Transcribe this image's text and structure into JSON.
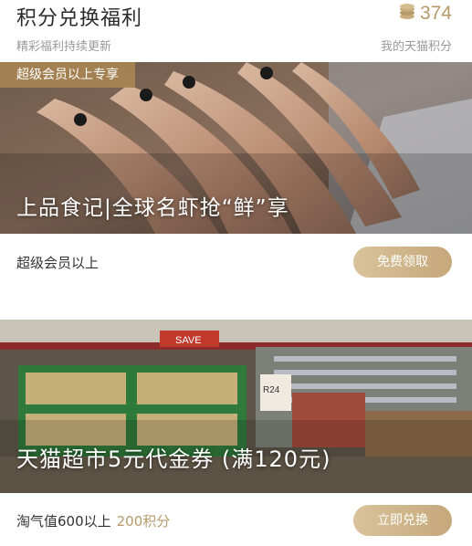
{
  "header": {
    "title": "积分兑换福利",
    "subtitle": "精彩福利持续更新",
    "points_value": "374",
    "points_label": "我的天猫积分",
    "coin_icon": "coins-icon"
  },
  "colors": {
    "accent_gold": "#b69a6a",
    "button_gradient_start": "#d9c29b",
    "button_gradient_end": "#c5a87a",
    "tag_bg": "#a88452"
  },
  "cards": [
    {
      "tag": "超级会员以上专享",
      "banner_title": "上品食记|全球名虾抢“鲜”享",
      "requirement": "超级会员以上",
      "cost": "",
      "button_label": "免费领取"
    },
    {
      "tag": "",
      "banner_title": "天猫超市5元代金券 (满120元)",
      "requirement": "淘气值600以上",
      "cost": "200积分",
      "button_label": "立即兑换",
      "banner_sign_1": "SAVE",
      "banner_sign_2": "R24"
    }
  ]
}
